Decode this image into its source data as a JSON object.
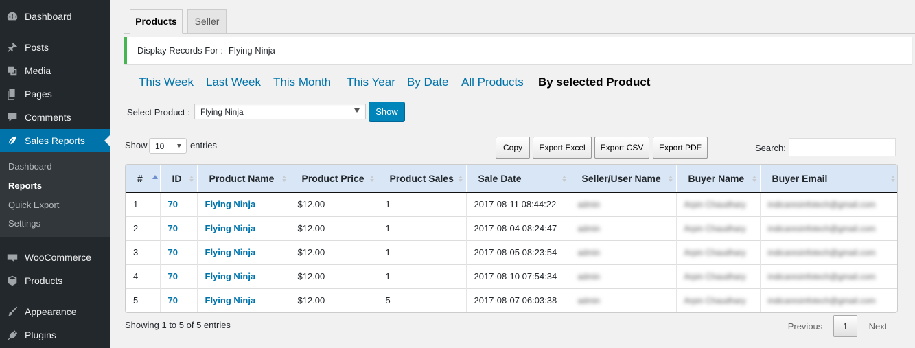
{
  "sidebar": {
    "items": [
      {
        "label": "Dashboard",
        "icon": "dashboard-icon"
      },
      {
        "label": "Posts",
        "icon": "pin-icon"
      },
      {
        "label": "Media",
        "icon": "media-icon"
      },
      {
        "label": "Pages",
        "icon": "pages-icon"
      },
      {
        "label": "Comments",
        "icon": "comment-icon"
      },
      {
        "label": "Sales Reports",
        "icon": "sales-reports-icon"
      },
      {
        "label": "WooCommerce",
        "icon": "woo-icon"
      },
      {
        "label": "Products",
        "icon": "box-icon"
      },
      {
        "label": "Appearance",
        "icon": "brush-icon"
      },
      {
        "label": "Plugins",
        "icon": "plugin-icon"
      }
    ],
    "submenu": [
      "Dashboard",
      "Reports",
      "Quick Export",
      "Settings"
    ]
  },
  "tabs": [
    "Products",
    "Seller"
  ],
  "notice": "Display Records For :- Flying Ninja",
  "filters": [
    "This Week",
    "Last Week",
    "This Month",
    "This Year",
    "By Date",
    "All Products",
    "By selected Product"
  ],
  "select_product": {
    "label": "Select Product :",
    "value": "Flying Ninja",
    "button": "Show"
  },
  "length": {
    "prefix": "Show",
    "value": "10",
    "suffix": "entries"
  },
  "export_buttons": [
    "Copy",
    "Export Excel",
    "Export CSV",
    "Export PDF"
  ],
  "search_label": "Search:",
  "table": {
    "headers": [
      "#",
      "ID",
      "Product Name",
      "Product Price",
      "Product Sales",
      "Sale Date",
      "Seller/User Name",
      "Buyer Name",
      "Buyer Email"
    ],
    "rows": [
      [
        "1",
        "70",
        "Flying Ninja",
        "$12.00",
        "1",
        "2017-08-11 08:44:22",
        "admin",
        "Arpin Chaudhary",
        "indicaresinfotech@gmail.com"
      ],
      [
        "2",
        "70",
        "Flying Ninja",
        "$12.00",
        "1",
        "2017-08-04 08:24:47",
        "admin",
        "Arpin Chaudhary",
        "indicaresinfotech@gmail.com"
      ],
      [
        "3",
        "70",
        "Flying Ninja",
        "$12.00",
        "1",
        "2017-08-05 08:23:54",
        "admin",
        "Arpin Chaudhary",
        "indicaresinfotech@gmail.com"
      ],
      [
        "4",
        "70",
        "Flying Ninja",
        "$12.00",
        "1",
        "2017-08-10 07:54:34",
        "admin",
        "Arpin Chaudhary",
        "indicaresinfotech@gmail.com"
      ],
      [
        "5",
        "70",
        "Flying Ninja",
        "$12.00",
        "5",
        "2017-08-07 06:03:38",
        "admin",
        "Arpin Chaudhary",
        "indicaresinfotech@gmail.com"
      ]
    ]
  },
  "info": "Showing 1 to 5 of 5 entries",
  "pagination": {
    "previous": "Previous",
    "current": "1",
    "next": "Next"
  }
}
